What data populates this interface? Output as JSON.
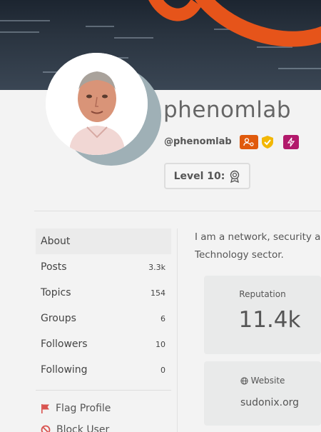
{
  "profile": {
    "display_name": "phenomlab",
    "handle": "@phenomlab",
    "level": "Level 10:",
    "about": "I am a network, security a Technology sector."
  },
  "about_lines": [
    "I am a network, security a",
    "Technology sector."
  ],
  "nav": {
    "items": [
      {
        "label": "About",
        "count": ""
      },
      {
        "label": "Posts",
        "count": "3.3k"
      },
      {
        "label": "Topics",
        "count": "154"
      },
      {
        "label": "Groups",
        "count": "6"
      },
      {
        "label": "Followers",
        "count": "10"
      },
      {
        "label": "Following",
        "count": "0"
      }
    ],
    "actions": [
      {
        "label": "Flag Profile",
        "icon": "flag-icon"
      },
      {
        "label": "Block User",
        "icon": "block-icon"
      }
    ]
  },
  "stats": {
    "reputation_label": "Reputation",
    "reputation_value": "11.4k",
    "website_label": "Website",
    "website_value": "sudonix.org"
  },
  "colors": {
    "accent": "#e6541a",
    "badge_staff": "#e05a0c",
    "badge_bolt": "#b2196b",
    "verified": "#f2b705",
    "flag": "#d9534f"
  }
}
